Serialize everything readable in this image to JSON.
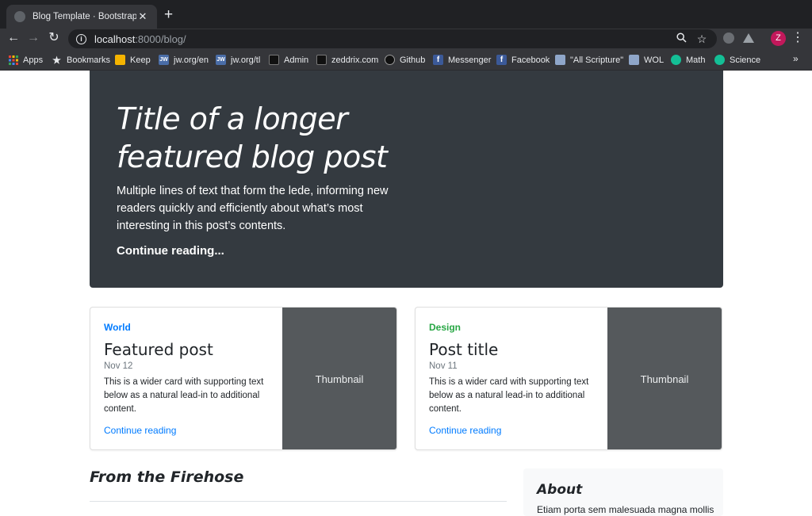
{
  "browser": {
    "tab_title": "Blog Template · Bootstrap",
    "tab_close": "✕",
    "new_tab": "+",
    "url_host": "localhost",
    "url_rest": ":8000/blog/",
    "profile_initial": "Z",
    "bookmarks": [
      {
        "label": "Apps",
        "icon": "apps-grid-icon"
      },
      {
        "label": "Bookmarks",
        "icon": "star-icon"
      },
      {
        "label": "Keep",
        "icon": "keep-icon",
        "color": "#f6b400"
      },
      {
        "label": "jw.org/en",
        "icon": "jw-icon",
        "color": "#4a6da7"
      },
      {
        "label": "jw.org/tl",
        "icon": "jw-icon",
        "color": "#4a6da7"
      },
      {
        "label": "Admin",
        "icon": "admin-icon",
        "color": "#111111"
      },
      {
        "label": "zeddrix.com",
        "icon": "zeddrix-icon",
        "color": "#111111"
      },
      {
        "label": "Github",
        "icon": "github-icon",
        "color": "#111111"
      },
      {
        "label": "Messenger",
        "icon": "facebook-icon",
        "color": "#3b5998"
      },
      {
        "label": "Facebook",
        "icon": "facebook-icon",
        "color": "#3b5998"
      },
      {
        "label": "\"All Scripture\"",
        "icon": "book-icon",
        "color": "#8fa6c9"
      },
      {
        "label": "WOL",
        "icon": "book-icon",
        "color": "#8fa6c9"
      },
      {
        "label": "Math",
        "icon": "khan-icon",
        "color": "#14bf96"
      },
      {
        "label": "Science",
        "icon": "khan-icon",
        "color": "#14bf96"
      }
    ],
    "bookmarks_more": "»"
  },
  "jumbotron": {
    "title": "Title of a longer featured blog post",
    "lede": "Multiple lines of text that form the lede, informing new readers quickly and efficiently about what’s most interesting in this post’s contents.",
    "link": "Continue reading..."
  },
  "cards": [
    {
      "category": "World",
      "category_color": "#007bff",
      "title": "Featured post",
      "date": "Nov 12",
      "text": "This is a wider card with supporting text below as a natural lead-in to additional content.",
      "link": "Continue reading",
      "thumbnail": "Thumbnail"
    },
    {
      "category": "Design",
      "category_color": "#28a745",
      "title": "Post title",
      "date": "Nov 11",
      "text": "This is a wider card with supporting text below as a natural lead-in to additional content.",
      "link": "Continue reading",
      "thumbnail": "Thumbnail"
    }
  ],
  "firehose": {
    "heading": "From the Firehose"
  },
  "sidebar": {
    "about_heading": "About",
    "about_text": "Etiam porta sem malesuada magna mollis"
  }
}
